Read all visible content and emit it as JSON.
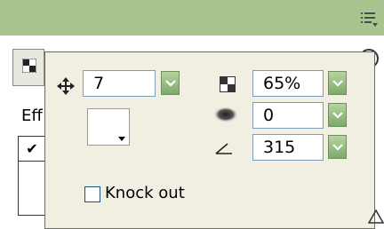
{
  "toolbar": {
    "menu_icon": "panel-menu-icon"
  },
  "background_panel": {
    "effects_label": "Eff",
    "row_check": "✔",
    "row_check2": "✔"
  },
  "popup": {
    "distance": {
      "value": "7",
      "icon": "move-arrows-icon"
    },
    "color": {
      "value": "#ffffff"
    },
    "alpha": {
      "value": "65%",
      "icon": "checker-icon"
    },
    "blur": {
      "value": "0",
      "icon": "blur-icon"
    },
    "angle": {
      "value": "315",
      "icon": "angle-icon"
    },
    "knockout": {
      "label": "Knock out",
      "checked": false
    }
  }
}
